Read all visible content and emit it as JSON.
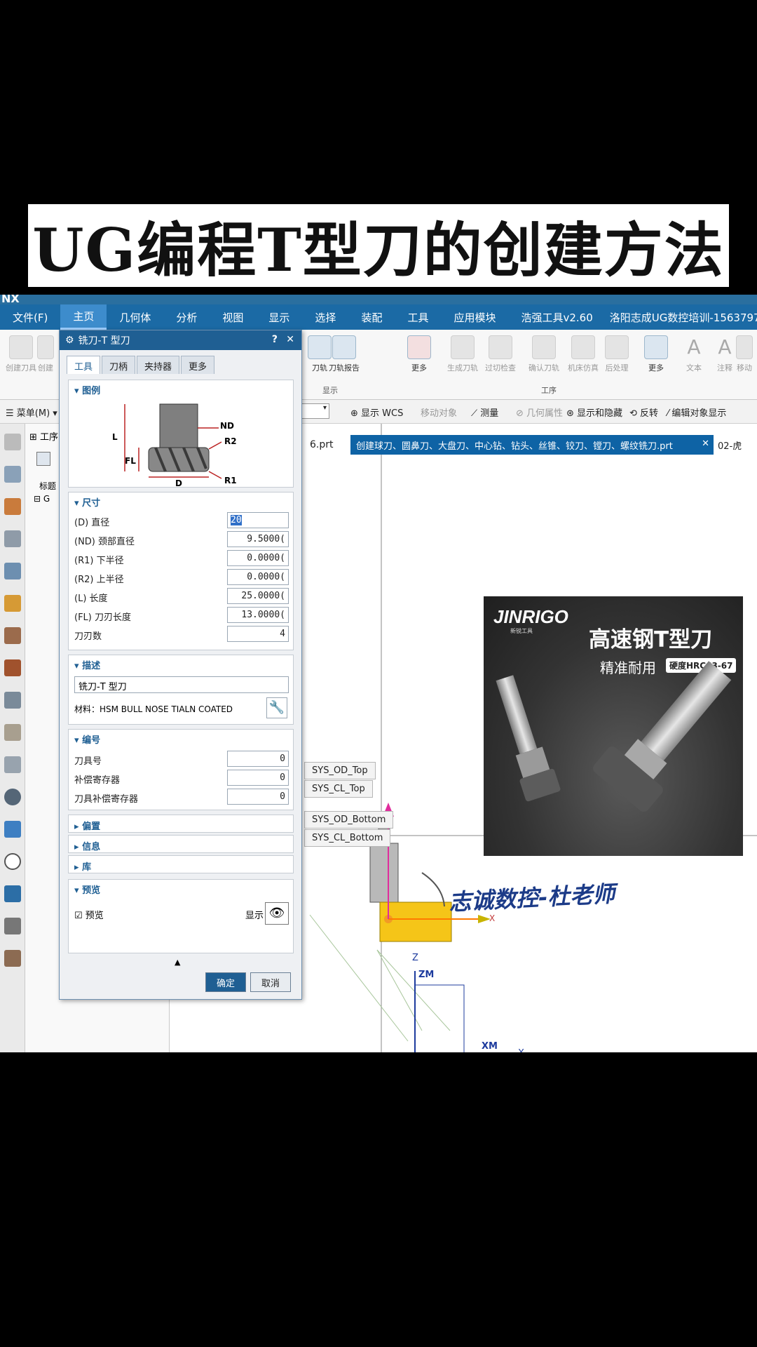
{
  "banner": {
    "title": "UG编程T型刀的创建方法"
  },
  "app": {
    "logo": "NX"
  },
  "menubar": {
    "items": [
      "文件(F)",
      "主页",
      "几何体",
      "分析",
      "视图",
      "显示",
      "选择",
      "装配",
      "工具",
      "应用模块",
      "浩强工具v2.60",
      "洛阳志成UG数控培训-15637975382"
    ],
    "active_index": 1
  },
  "ribbon": {
    "left_buttons": [
      "创建刀具",
      "创建"
    ],
    "buttons": [
      "刀轨",
      "刀轨报告",
      "更多",
      "生成刀轨",
      "过切检查",
      "确认刀轨",
      "机床仿真",
      "后处理",
      "更多",
      "文本",
      "注释",
      "移动"
    ],
    "group_display": "显示",
    "group_operation": "工序"
  },
  "toolbar2": {
    "menu": "菜单(M)",
    "items": [
      "显示 WCS",
      "移动对象",
      "测量",
      "几何属性",
      "显示和隐藏",
      "反转",
      "编辑对象显示"
    ]
  },
  "navigator": {
    "title": "工序",
    "column_header": "标题",
    "row": "G"
  },
  "doc_tabs": {
    "prev": "6.prt",
    "active": "创建球刀、圆鼻刀、大盘刀、中心钻、钻头、丝锥、铰刀、镗刀、螺纹铣刀.prt",
    "next": "02-虎"
  },
  "dialog": {
    "title": "铣刀-T 型刀",
    "help": "?",
    "close": "✕",
    "tabs": [
      "工具",
      "刀柄",
      "夹持器",
      "更多"
    ],
    "legend": {
      "heading": "图例",
      "labels": {
        "ND": "ND",
        "R2": "R2",
        "L": "L",
        "FL": "FL",
        "D": "D",
        "R1": "R1"
      }
    },
    "size": {
      "heading": "尺寸",
      "fields": [
        {
          "label": "(D) 直径",
          "value": "20"
        },
        {
          "label": "(ND) 颈部直径",
          "value": "9.5000("
        },
        {
          "label": "(R1) 下半径",
          "value": "0.0000("
        },
        {
          "label": "(R2) 上半径",
          "value": "0.0000("
        },
        {
          "label": "(L) 长度",
          "value": "25.0000("
        },
        {
          "label": "(FL) 刀刃长度",
          "value": "13.0000("
        },
        {
          "label": "刀刃数",
          "value": "4"
        }
      ]
    },
    "description": {
      "heading": "描述",
      "text": "铣刀-T 型刀",
      "material": "材料：HSM BULL NOSE TIALN COATED"
    },
    "number": {
      "heading": "编号",
      "fields": [
        {
          "label": "刀具号",
          "value": "0"
        },
        {
          "label": "补偿寄存器",
          "value": "0"
        },
        {
          "label": "刀具补偿寄存器",
          "value": "0"
        }
      ]
    },
    "collapsed": [
      "偏置",
      "信息",
      "库"
    ],
    "preview": {
      "heading": "预览",
      "checkbox": "预览",
      "show": "显示"
    },
    "ok": "确定",
    "cancel": "取消"
  },
  "viewport": {
    "orient_labels": [
      "SYS_OD_Top",
      "SYS_CL_Top",
      "SYS_OD_Bottom",
      "SYS_CL_Bottom"
    ],
    "axes": {
      "z": "Z",
      "zm": "ZM",
      "xm": "XM",
      "x": "X",
      "ym": "YM"
    }
  },
  "product_photo": {
    "brand": "JINRIGO",
    "brand_sub": "新锐工具",
    "title": "高速钢T型刀",
    "subtitle": "精准耐用",
    "badge": "硬度HRC63-67"
  },
  "watermark": "志诚数控-杜老师"
}
